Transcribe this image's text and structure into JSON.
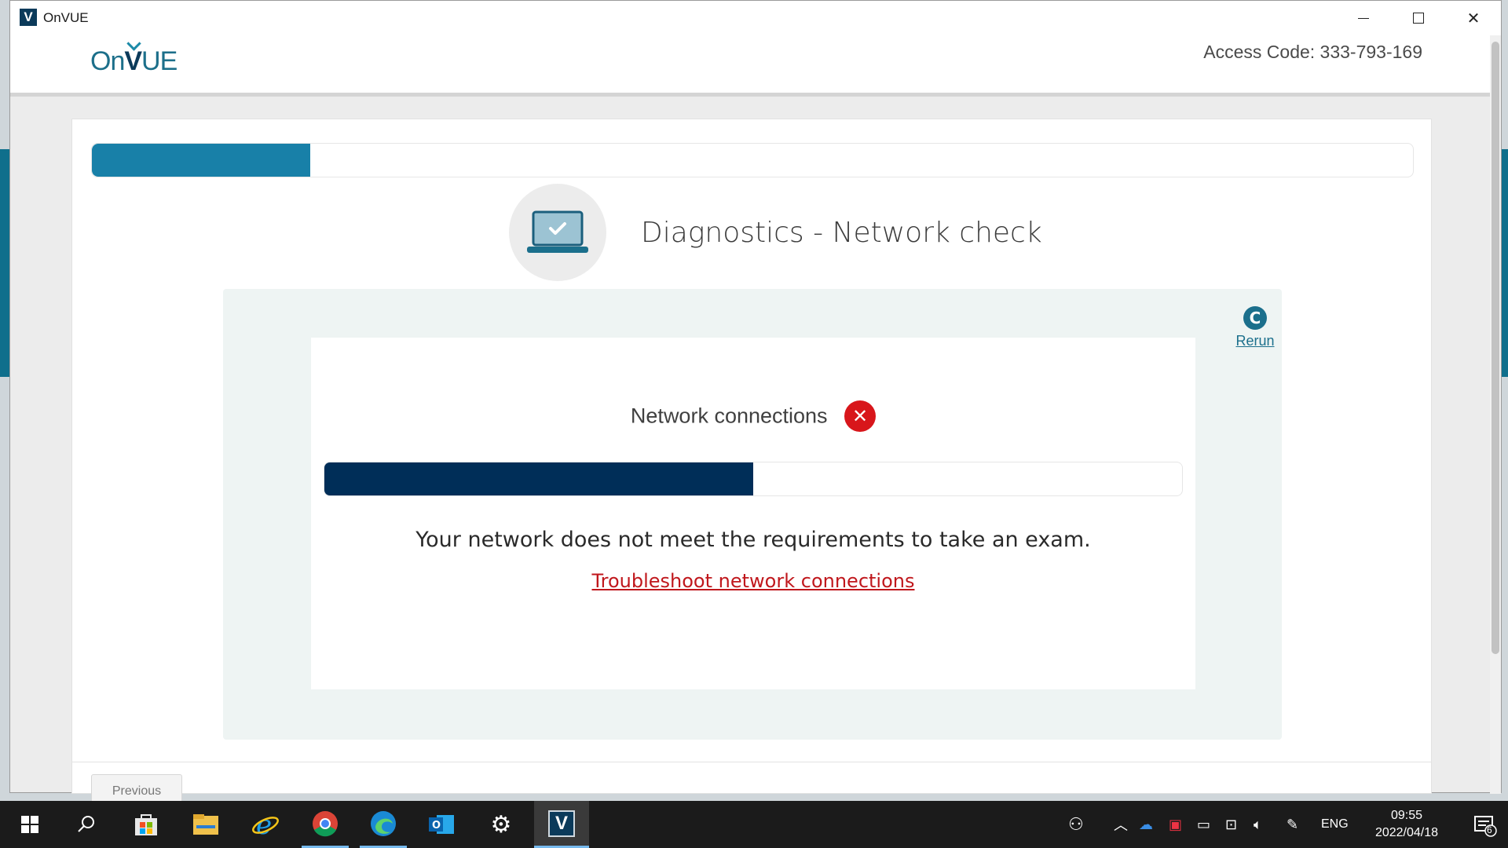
{
  "window": {
    "title": "OnVUE",
    "app_icon": "V",
    "controls": {
      "minimize": "minimize-icon",
      "maximize": "maximize-icon",
      "close": "close-icon"
    }
  },
  "header": {
    "logo_on": "On",
    "logo_v": "V",
    "logo_ue": "UE",
    "access_code": "Access Code: 333-793-169"
  },
  "wizard": {
    "progress_fraction": 0.165,
    "title": "Diagnostics - Network check",
    "hero_icon": "laptop-check-icon"
  },
  "check": {
    "rerun_label": "Rerun",
    "rerun_icon": "C",
    "name": "Network connections",
    "status": "failed",
    "status_icon": "✕",
    "progress_fraction": 0.5,
    "message": "Your network does not meet the requirements to take an exam.",
    "troubleshoot_link": "Troubleshoot network connections"
  },
  "footer": {
    "previous_label": "Previous"
  },
  "colors": {
    "accent": "#1880a8",
    "bar_dark": "#002e58",
    "error": "#d8161b",
    "link_error": "#c0171c"
  },
  "taskbar": {
    "apps": [
      "start-icon",
      "search-icon",
      "store-icon",
      "file-explorer-icon",
      "internet-explorer-icon",
      "chrome-icon",
      "edge-icon",
      "outlook-icon",
      "settings-icon",
      "onvue-icon"
    ],
    "onvue_label": "V",
    "language": "ENG",
    "time": "09:55",
    "date": "2022/04/18",
    "notification_count": "6"
  }
}
